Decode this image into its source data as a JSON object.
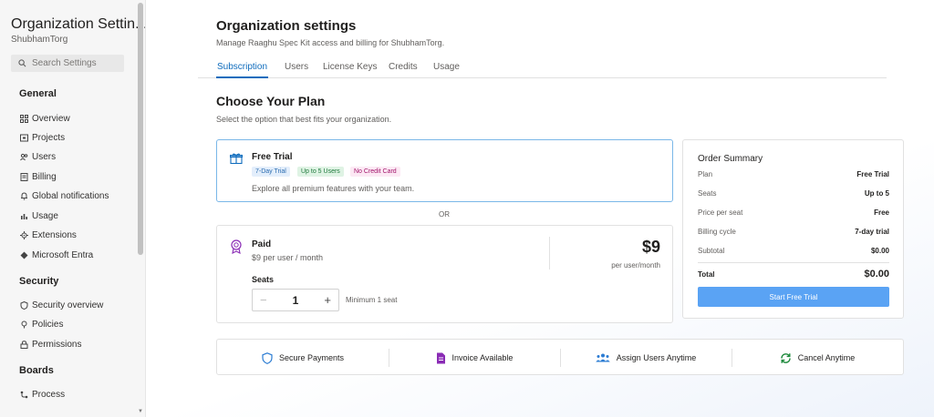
{
  "sidebar": {
    "title": "Organization Settin...",
    "org": "ShubhamTorg",
    "search_placeholder": "Search Settings",
    "sections": [
      {
        "title": "General",
        "items": [
          {
            "label": "Overview",
            "icon": "grid-icon"
          },
          {
            "label": "Projects",
            "icon": "project-icon"
          },
          {
            "label": "Users",
            "icon": "users-icon"
          },
          {
            "label": "Billing",
            "icon": "billing-icon"
          },
          {
            "label": "Global notifications",
            "icon": "notification-icon"
          },
          {
            "label": "Usage",
            "icon": "usage-icon"
          },
          {
            "label": "Extensions",
            "icon": "extensions-icon"
          },
          {
            "label": "Microsoft Entra",
            "icon": "entra-icon"
          }
        ]
      },
      {
        "title": "Security",
        "items": [
          {
            "label": "Security overview",
            "icon": "shield-icon"
          },
          {
            "label": "Policies",
            "icon": "policy-icon"
          },
          {
            "label": "Permissions",
            "icon": "lock-icon"
          }
        ]
      },
      {
        "title": "Boards",
        "items": [
          {
            "label": "Process",
            "icon": "process-icon"
          }
        ]
      }
    ]
  },
  "header": {
    "title": "Organization settings",
    "subtitle": "Manage Raaghu Spec Kit access and billing for ShubhamTorg."
  },
  "tabs": [
    "Subscription",
    "Users",
    "License Keys",
    "Credits",
    "Usage"
  ],
  "active_tab": "Subscription",
  "plan": {
    "title": "Choose Your Plan",
    "subtitle": "Select the option that best fits your organization.",
    "or_label": "OR",
    "free": {
      "title": "Free Trial",
      "badges": [
        "7-Day Trial",
        "Up to 5 Users",
        "No Credit Card"
      ],
      "description": "Explore all premium features with your team."
    },
    "paid": {
      "title": "Paid",
      "rate": "$9 per user / month",
      "price": "$9",
      "price_unit": "per user/month",
      "seats_label": "Seats",
      "seats_value": "1",
      "minus": "−",
      "plus": "+",
      "minimum": "Minimum 1 seat"
    }
  },
  "summary": {
    "title": "Order Summary",
    "rows": [
      {
        "label": "Plan",
        "value": "Free Trial"
      },
      {
        "label": "Seats",
        "value": "Up to 5"
      },
      {
        "label": "Price per seat",
        "value": "Free"
      },
      {
        "label": "Billing cycle",
        "value": "7-day trial"
      },
      {
        "label": "Subtotal",
        "value": "$0.00"
      }
    ],
    "total_label": "Total",
    "total_value": "$0.00",
    "button": "Start Free Trial"
  },
  "features": [
    {
      "label": "Secure Payments",
      "icon": "shield-icon",
      "color": "#2b7cd3"
    },
    {
      "label": "Invoice Available",
      "icon": "invoice-icon",
      "color": "#8a2bb5"
    },
    {
      "label": "Assign Users Anytime",
      "icon": "users-icon",
      "color": "#2b7cd3"
    },
    {
      "label": "Cancel Anytime",
      "icon": "refresh-icon",
      "color": "#1e8a3c"
    }
  ],
  "colors": {
    "accent": "#0f6cbd",
    "button": "#5aa3f4",
    "free_border": "#7ab7e8"
  }
}
